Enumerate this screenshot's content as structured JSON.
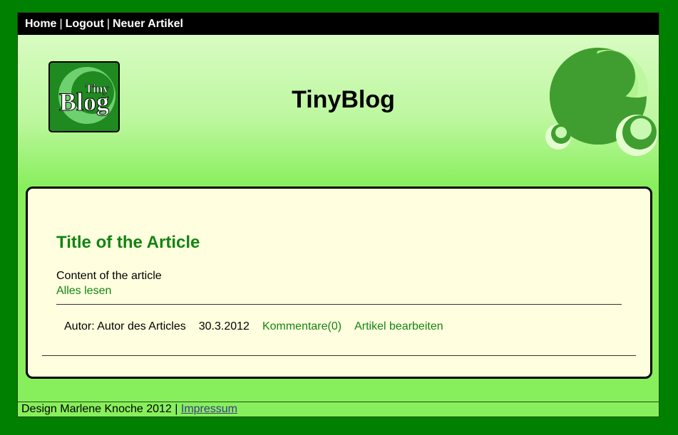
{
  "nav": {
    "home": "Home",
    "separator": "|",
    "logout": "Logout",
    "new_article": "Neuer Artikel"
  },
  "header": {
    "site_title": "TinyBlog",
    "logo_text_small": "Tiny",
    "logo_text_large": "Blog"
  },
  "article": {
    "title": "Title of the Article",
    "content": "Content of the article",
    "read_more": "Alles lesen",
    "author": "Autor: Autor des Articles",
    "date": "30.3.2012",
    "comments": "Kommentare(0)",
    "edit": "Artikel bearbeiten"
  },
  "footer": {
    "credit": "Design Marlene Knoche 2012",
    "separator": "|",
    "impressum": "Impressum"
  },
  "colors": {
    "page_border": "#008000",
    "background": "#88ef5c",
    "card": "#ffffdf",
    "link_green": "#128412"
  }
}
